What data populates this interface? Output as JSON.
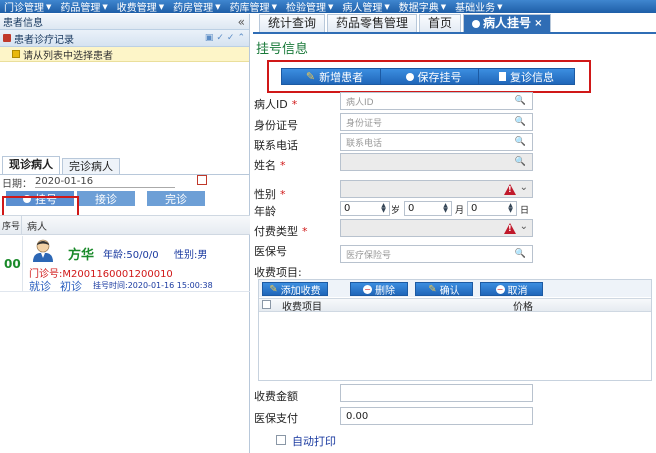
{
  "menu": [
    "门诊管理",
    "药品管理",
    "收费管理",
    "药房管理",
    "药库管理",
    "检验管理",
    "病人管理",
    "数据字典",
    "基础业务"
  ],
  "left": {
    "panel_title": "患者信息",
    "collapse": "«",
    "record_title": "患者诊疗记录",
    "select_hint": "请从列表中选择患者",
    "tabs": [
      "现诊病人",
      "完诊病人"
    ],
    "date_label": "日期：",
    "date_value": "2020-01-16",
    "buttons": {
      "register": "挂号",
      "receive": "接诊",
      "finish": "完诊"
    },
    "grid": {
      "col_no": "序号",
      "col_patient": "病人"
    },
    "patient": {
      "no": "00",
      "name": "方华",
      "age": "年龄:50/0/0",
      "gender": "性别:男",
      "clinic_no": "门诊号:M2001160001200010",
      "status": "就诊",
      "visit_type": "初诊",
      "reg_time": "挂号时间:2020-01-16 15:00:38"
    }
  },
  "tabs": {
    "t1": "统计查询",
    "t2": "药品零售管理",
    "t3": "首页",
    "t4": "病人挂号",
    "close": "×"
  },
  "form": {
    "title": "挂号信息",
    "actions": {
      "new": "新增患者",
      "save": "保存挂号",
      "revisit": "复诊信息"
    },
    "patient_id": {
      "label": "病人ID",
      "placeholder": "病人ID"
    },
    "id_card": {
      "label": "身份证号",
      "placeholder": "身份证号"
    },
    "phone": {
      "label": "联系电话",
      "placeholder": "联系电话"
    },
    "name": {
      "label": "姓名"
    },
    "gender": {
      "label": "性别"
    },
    "age": {
      "label": "年龄",
      "years": "0",
      "years_unit": "岁",
      "months": "0",
      "months_unit": "月",
      "days": "0",
      "days_unit": "日"
    },
    "pay_type": {
      "label": "付费类型"
    },
    "insurance_no": {
      "label": "医保号",
      "placeholder": "医疗保险号"
    },
    "items_label": "收费项目:",
    "items_buttons": {
      "add": "添加收费",
      "delete": "删除",
      "confirm": "确认",
      "cancel": "取消"
    },
    "items_cols": {
      "item": "收费项目",
      "price": "价格"
    },
    "amount": {
      "label": "收费金额",
      "value": ""
    },
    "insurance_pay": {
      "label": "医保支付",
      "value": "0.00"
    },
    "auto_print": "自动打印"
  }
}
